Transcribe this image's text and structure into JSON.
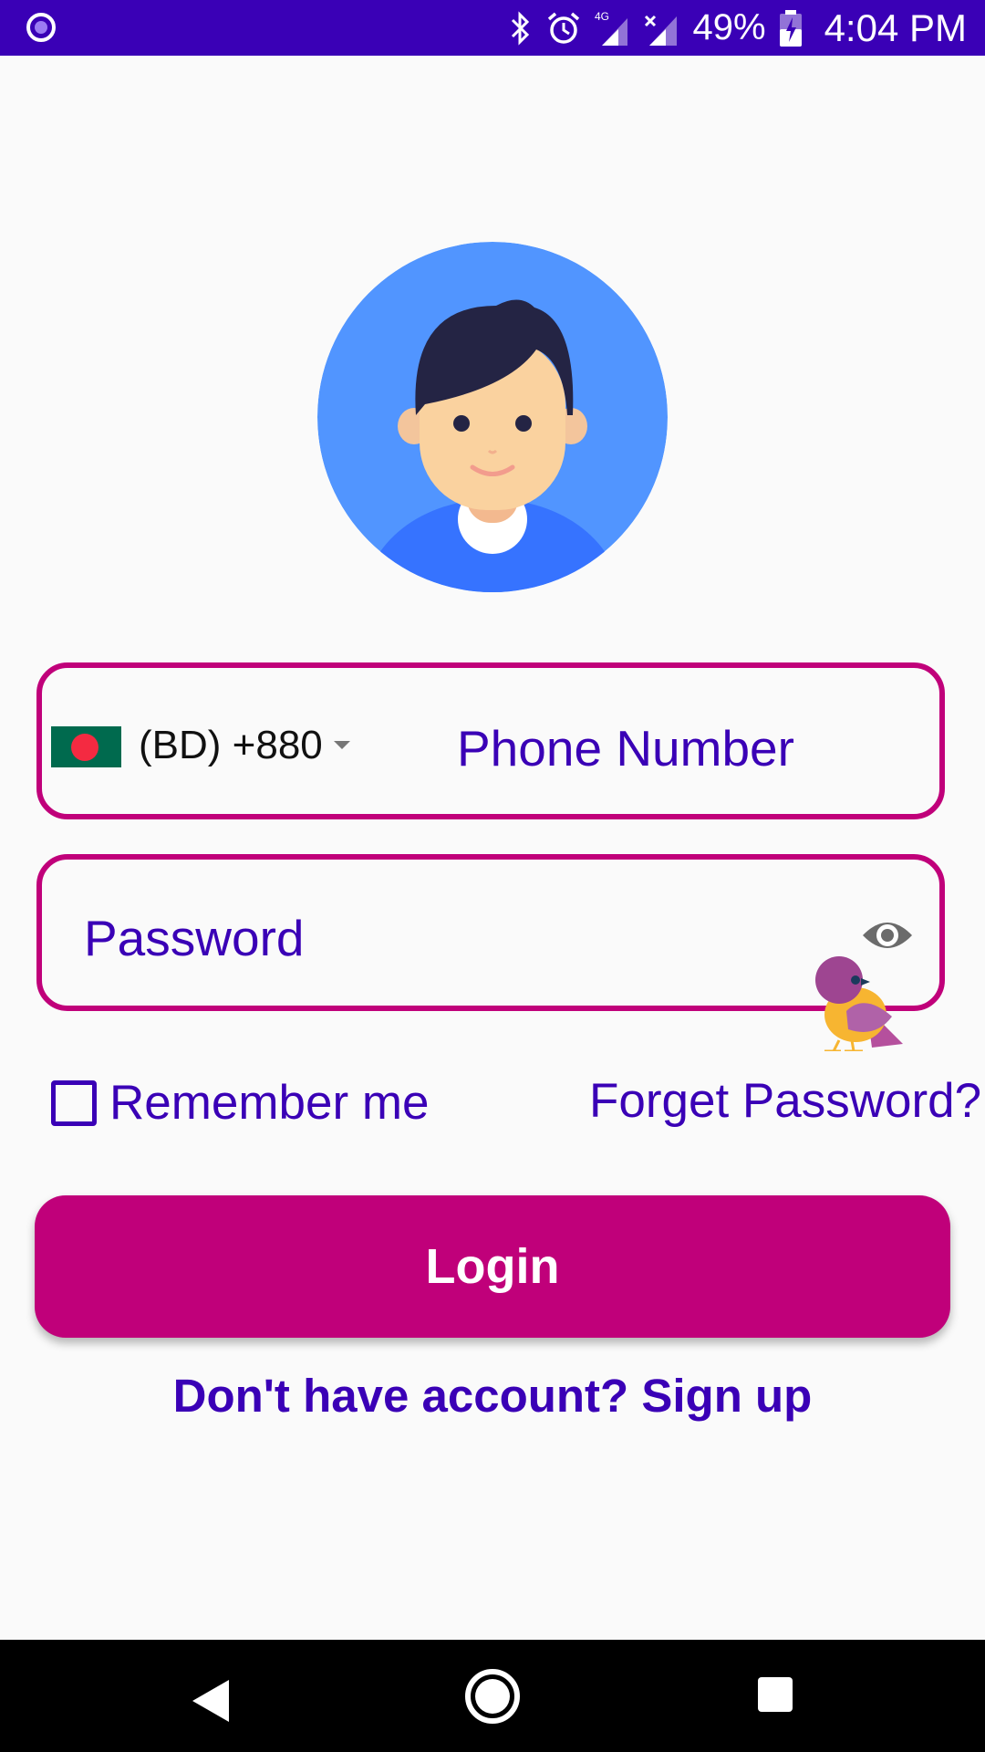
{
  "status_bar": {
    "battery": "49%",
    "time": "4:04 PM",
    "network": "4G"
  },
  "phone_field": {
    "country_code": "(BD) +880",
    "placeholder": "Phone Number"
  },
  "password_field": {
    "placeholder": "Password"
  },
  "options": {
    "remember_label": "Remember me",
    "remember_checked": false,
    "forgot_label": "Forget Password?"
  },
  "login_button": {
    "label": "Login"
  },
  "signup_link": {
    "label": "Don't have account? Sign up"
  },
  "colors": {
    "primary": "#3a00b6",
    "accent": "#c0007a",
    "avatar_bg": "#5195ff"
  },
  "icons": [
    "app-notification-icon",
    "bluetooth-icon",
    "alarm-icon",
    "signal-icon",
    "battery-icon",
    "flag-bd-icon",
    "dropdown-caret-icon",
    "eye-icon",
    "bird-icon",
    "back-icon",
    "home-icon",
    "recents-icon"
  ]
}
